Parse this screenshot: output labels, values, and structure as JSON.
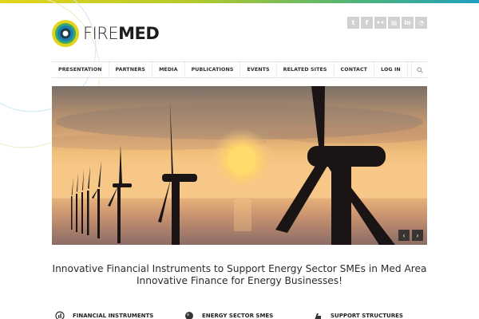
{
  "brand": {
    "name_light": "FIRE",
    "name_bold": "MED",
    "colors": {
      "blue": "#1b7fb3",
      "green": "#3aa76d",
      "yellow": "#e2d418",
      "dark": "#1c3b4a"
    }
  },
  "social": [
    {
      "icon": "twitter-icon",
      "glyph": "t"
    },
    {
      "icon": "facebook-icon",
      "glyph": "f"
    },
    {
      "icon": "flickr-icon",
      "glyph": "••"
    },
    {
      "icon": "storage-icon",
      "glyph": "▤"
    },
    {
      "icon": "linkedin-icon",
      "glyph": "in"
    },
    {
      "icon": "rss-icon",
      "glyph": "◔"
    }
  ],
  "nav": {
    "items": [
      "PRESENTATION",
      "PARTNERS",
      "MEDIA",
      "PUBLICATIONS",
      "EVENTS",
      "RELATED SITES",
      "CONTACT",
      "LOG IN"
    ],
    "search_icon": "search-icon"
  },
  "slider": {
    "prev": "‹",
    "next": "›"
  },
  "tagline": {
    "line1": "Innovative Financial Instruments to Support Energy Sector SMEs in Med Area",
    "line2": "Innovative Finance for Energy Businesses!"
  },
  "features": [
    {
      "icon": "chart-icon",
      "label": "FINANCIAL INSTRUMENTS"
    },
    {
      "icon": "energy-sme-icon",
      "label": "ENERGY SECTOR SMES"
    },
    {
      "icon": "support-icon",
      "label": "SUPPORT STRUCTURES"
    }
  ]
}
